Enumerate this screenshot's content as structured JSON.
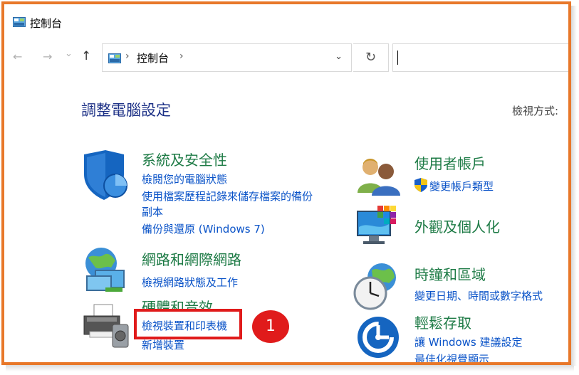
{
  "window": {
    "title": "控制台"
  },
  "toolbar": {
    "back_icon": "←",
    "forward_icon": "→",
    "recent_icon": "⌄",
    "up_icon": "↑",
    "breadcrumb_sep": "›",
    "breadcrumb_item": "控制台",
    "dropdown_icon": "⌄",
    "refresh_icon": "↻"
  },
  "page": {
    "heading": "調整電腦設定",
    "view_by_label": "檢視方式:"
  },
  "categories_left": [
    {
      "title": "系統及安全性",
      "links": [
        "檢閱您的電腦狀態",
        "使用檔案歷程記錄來儲存檔案的備份",
        "副本",
        "備份與還原 (Windows 7)"
      ]
    },
    {
      "title": "網路和網際網路",
      "links": [
        "檢視網路狀態及工作"
      ]
    },
    {
      "title": "硬體和音效",
      "links": [
        "檢視裝置和印表機",
        "新增裝置"
      ]
    }
  ],
  "categories_right": [
    {
      "title": "使用者帳戶",
      "links": [
        "變更帳戶類型"
      ]
    },
    {
      "title": "外觀及個人化",
      "links": []
    },
    {
      "title": "時鐘和區域",
      "links": [
        "變更日期、時間或數字格式"
      ]
    },
    {
      "title": "輕鬆存取",
      "links": [
        "讓 Windows 建議設定",
        "最佳化視覺顯示"
      ]
    }
  ],
  "callout": {
    "number": "1"
  },
  "colors": {
    "accent_border": "#e8782a",
    "highlight": "#e01b1b",
    "link": "#0a53c8",
    "category": "#1e7b46",
    "heading": "#1e3287"
  }
}
